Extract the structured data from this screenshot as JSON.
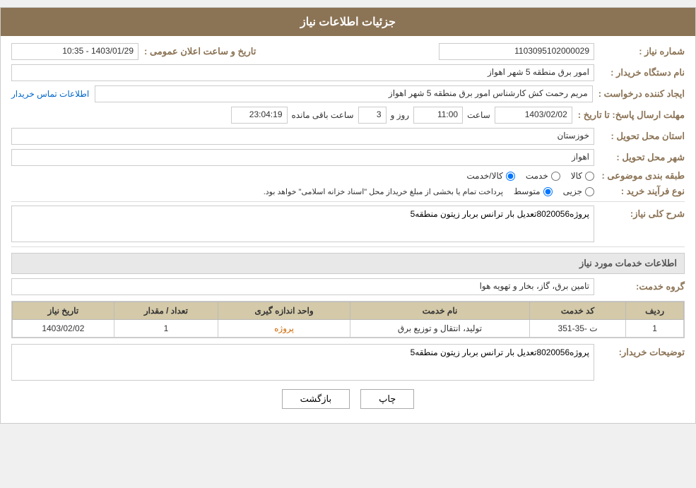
{
  "page": {
    "title": "جزئیات اطلاعات نیاز"
  },
  "header": {
    "title": "جزئیات اطلاعات نیاز"
  },
  "fields": {
    "need_number_label": "شماره نیاز :",
    "need_number_value": "1103095102000029",
    "buyer_station_label": "نام دستگاه خریدار :",
    "buyer_station_value": "امور برق منطقه 5 شهر اهواز",
    "requester_label": "ایجاد کننده درخواست :",
    "requester_value": "مریم رحمت کش کارشناس امور برق منطقه 5 شهر اهواز",
    "contact_link": "اطلاعات تماس خریدار",
    "response_deadline_label": "مهلت ارسال پاسخ: تا تاریخ :",
    "response_date": "1403/02/02",
    "response_time_label": "ساعت",
    "response_time": "11:00",
    "response_days_label": "روز و",
    "response_days": "3",
    "remaining_time_label": "ساعت باقی مانده",
    "remaining_time": "23:04:19",
    "delivery_province_label": "استان محل تحویل :",
    "delivery_province_value": "خوزستان",
    "delivery_city_label": "شهر محل تحویل :",
    "delivery_city_value": "اهواز",
    "category_label": "طبقه بندی موضوعی :",
    "category_options": [
      "کالا",
      "خدمت",
      "کالا/خدمت"
    ],
    "category_selected": "کالا",
    "purchase_type_label": "نوع فرآیند خرید :",
    "purchase_type_options": [
      "جزیی",
      "متوسط"
    ],
    "purchase_type_selected": "متوسط",
    "purchase_type_note": "پرداخت تمام یا بخشی از مبلغ خریداز محل \"اسناد خزانه اسلامی\" خواهد بود.",
    "announcement_datetime_label": "تاریخ و ساعت اعلان عمومی :",
    "announcement_datetime_value": "1403/01/29 - 10:35"
  },
  "need_description": {
    "section_title": "شرح کلی نیاز:",
    "text": "پروژه8020056تعدیل بار ترانس بربار زیتون منطقه5"
  },
  "service_info": {
    "section_title": "اطلاعات خدمات مورد نیاز",
    "service_group_label": "گروه خدمت:",
    "service_group_value": "تامین برق، گاز، بخار و تهویه هوا"
  },
  "table": {
    "headers": [
      "ردیف",
      "کد خدمت",
      "نام خدمت",
      "واحد اندازه گیری",
      "تعداد / مقدار",
      "تاریخ نیاز"
    ],
    "rows": [
      {
        "row": "1",
        "code": "ت -35-351",
        "name": "تولید، انتقال و توزیع برق",
        "unit": "پروژه",
        "quantity": "1",
        "date": "1403/02/02"
      }
    ]
  },
  "buyer_description": {
    "section_title": "توضیحات خریدار:",
    "text": "پروژه8020056تعدیل بار ترانس بربار زیتون منطقه5"
  },
  "buttons": {
    "print": "چاپ",
    "back": "بازگشت"
  }
}
